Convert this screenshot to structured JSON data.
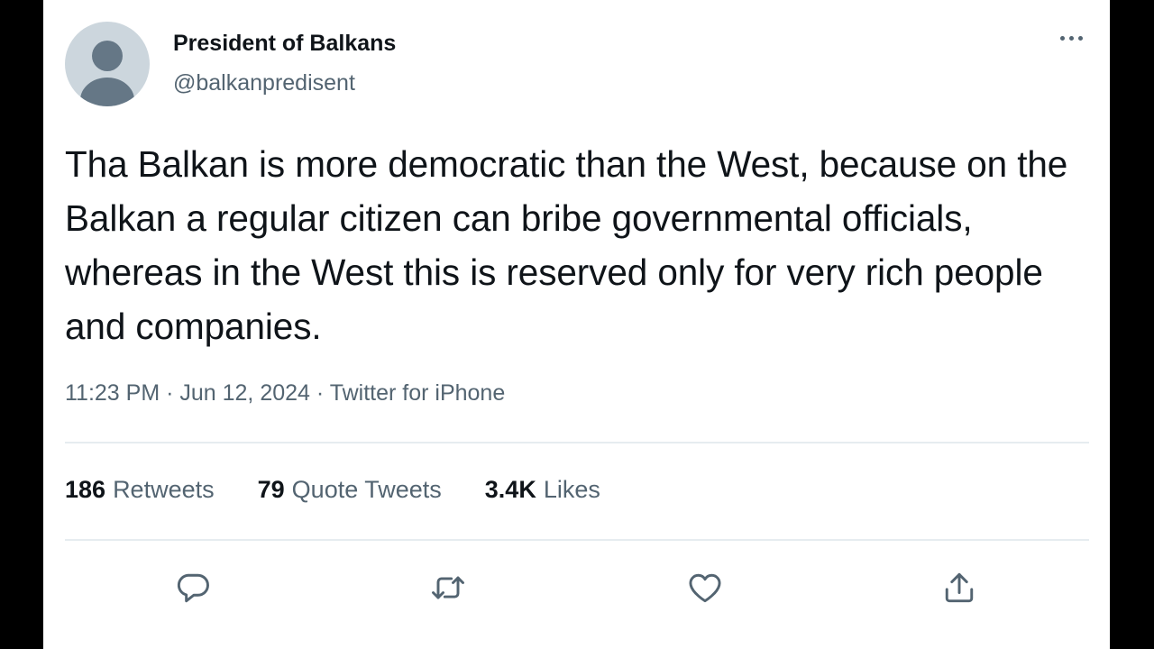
{
  "author": {
    "display_name": "President of Balkans",
    "handle": "@balkanpredisent"
  },
  "tweet": {
    "text": "Tha Balkan is more democratic than the West, because on the Balkan a regular citizen can bribe governmental officials, whereas in the West this is reserved only for very rich people and companies.",
    "meta": "11:23 PM · Jun 12, 2024 · Twitter for iPhone"
  },
  "stats": {
    "retweets_count": "186",
    "retweets_label": "Retweets",
    "quotes_count": "79",
    "quotes_label": "Quote Tweets",
    "likes_count": "3.4K",
    "likes_label": "Likes"
  },
  "actions": [
    "reply-icon",
    "retweet-icon",
    "like-icon",
    "share-icon"
  ],
  "colors": {
    "text": "#0f1419",
    "secondary": "#536471",
    "divider": "#e6ecf0",
    "avatar_bg": "#ccd6dd",
    "avatar_fg": "#657786"
  }
}
